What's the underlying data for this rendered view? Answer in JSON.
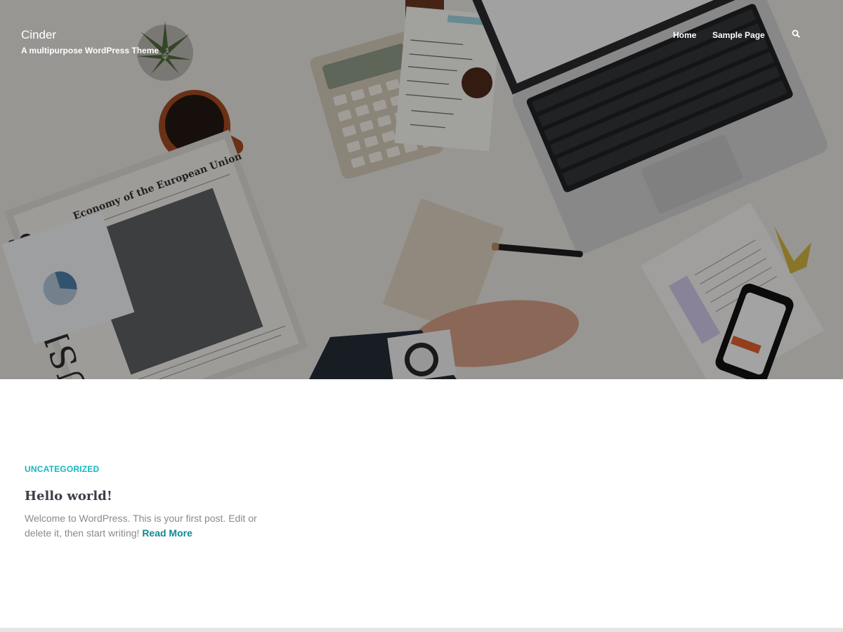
{
  "site": {
    "title": "Cinder",
    "tagline": "A multipurpose WordPress Theme"
  },
  "nav": {
    "items": [
      {
        "label": "Home"
      },
      {
        "label": "Sample Page"
      }
    ],
    "search_icon": "search-icon"
  },
  "hero": {
    "image": "desk-workspace-photo",
    "newspaper_headline": "BUSINESS",
    "newspaper_subheadline": "Economy of the European Union"
  },
  "post": {
    "category": "UNCATEGORIZED",
    "title": "Hello world!",
    "excerpt": "Welcome to WordPress. This is your first post. Edit or delete it, then start writing!",
    "read_more": "Read More"
  },
  "colors": {
    "accent": "#15b7c3",
    "link": "#0f8890",
    "title": "#3a3f47",
    "excerpt": "#8a8a8a"
  }
}
